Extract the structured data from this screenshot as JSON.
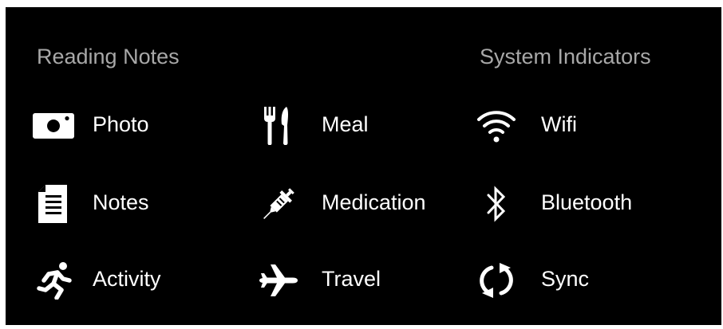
{
  "sections": {
    "reading_notes": {
      "title": "Reading Notes"
    },
    "system_indicators": {
      "title": "System Indicators"
    }
  },
  "reading_notes": [
    {
      "label": "Photo",
      "icon": "camera-icon"
    },
    {
      "label": "Notes",
      "icon": "document-icon"
    },
    {
      "label": "Activity",
      "icon": "runner-icon"
    },
    {
      "label": "Meal",
      "icon": "fork-knife-icon"
    },
    {
      "label": "Medication",
      "icon": "syringe-icon"
    },
    {
      "label": "Travel",
      "icon": "airplane-icon"
    }
  ],
  "system_indicators": [
    {
      "label": "Wifi",
      "icon": "wifi-icon"
    },
    {
      "label": "Bluetooth",
      "icon": "bluetooth-icon"
    },
    {
      "label": "Sync",
      "icon": "sync-icon"
    }
  ],
  "colors": {
    "background": "#000000",
    "section_title": "#a8a8a8",
    "label": "#ffffff",
    "icon": "#ffffff"
  }
}
